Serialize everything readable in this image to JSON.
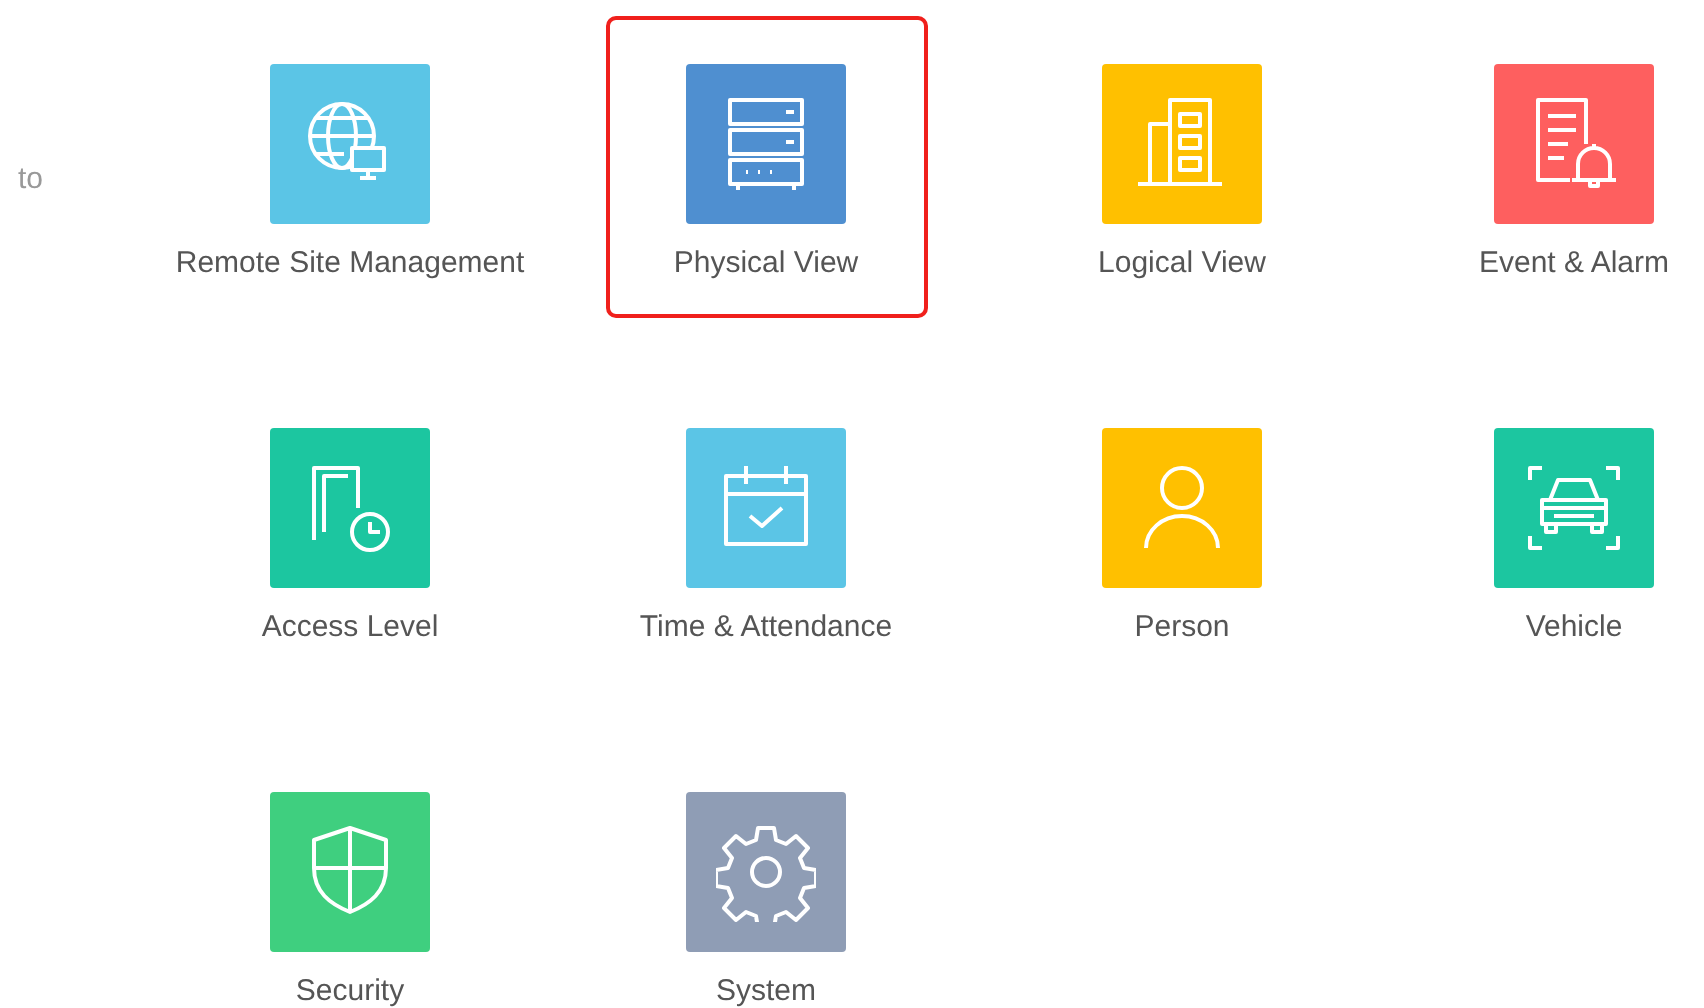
{
  "side_text": "to",
  "modules": [
    {
      "label": "Remote Site Management",
      "kind": "remote",
      "color": "#5bc5e6",
      "highlighted": false
    },
    {
      "label": "Physical View",
      "kind": "physical",
      "color": "#4f8fd0",
      "highlighted": true
    },
    {
      "label": "Logical View",
      "kind": "logical",
      "color": "#ffc000",
      "highlighted": false
    },
    {
      "label": "Event & Alarm",
      "kind": "event",
      "color": "#fe5f5f",
      "highlighted": false
    },
    {
      "label": "Access Level",
      "kind": "access",
      "color": "#1cc6a0",
      "highlighted": false
    },
    {
      "label": "Time & Attendance",
      "kind": "time",
      "color": "#5bc5e6",
      "highlighted": false
    },
    {
      "label": "Person",
      "kind": "person",
      "color": "#ffc000",
      "highlighted": false
    },
    {
      "label": "Vehicle",
      "kind": "vehicle",
      "color": "#1cc6a0",
      "highlighted": false
    },
    {
      "label": "Security",
      "kind": "security",
      "color": "#3fcf7f",
      "highlighted": false
    },
    {
      "label": "System",
      "kind": "system",
      "color": "#8f9db5",
      "highlighted": false
    }
  ]
}
